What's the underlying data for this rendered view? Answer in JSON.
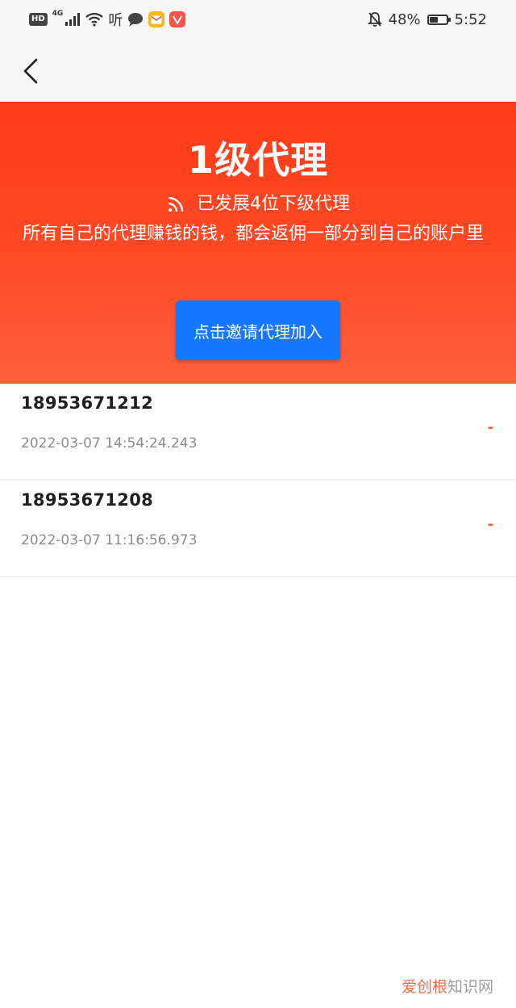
{
  "status_bar": {
    "hd": "HD",
    "network": "4G",
    "listen_icon": "听",
    "battery_percent": "48%",
    "battery_level": 0.48,
    "time": "5:52",
    "icons": [
      "hd-icon",
      "signal-icon",
      "wifi-icon",
      "listen-icon",
      "chat-icon",
      "mail-app-icon",
      "video-app-icon",
      "bell-off-icon",
      "battery-icon"
    ]
  },
  "nav": {
    "back_icon": "chevron-left-icon"
  },
  "hero": {
    "title": "1级代理",
    "subline_icon": "rss-icon",
    "subline": "已发展4位下级代理",
    "description": "所有自己的代理赚钱的钱，都会返佣一部分到自己的账户里",
    "invite_button": "点击邀请代理加入",
    "colors": {
      "gradient_top": "#ff3a16",
      "gradient_bottom": "#ff6040",
      "button": "#1677ff"
    }
  },
  "agents": [
    {
      "phone": "18953671212",
      "time": "2022-03-07 14:54:24.243",
      "amount": "-"
    },
    {
      "phone": "18953671208",
      "time": "2022-03-07 11:16:56.973",
      "amount": "-"
    }
  ],
  "watermark": {
    "brand": "爱创根",
    "suffix": "知识网"
  }
}
